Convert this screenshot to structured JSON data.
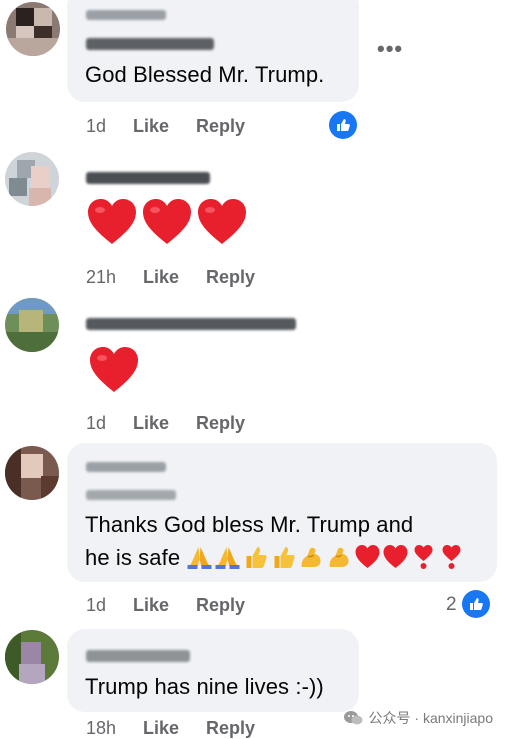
{
  "comments": [
    {
      "text": "God Blessed Mr. Trump.",
      "time": "1d",
      "like": "Like",
      "reply": "Reply",
      "more_icon": "•••"
    },
    {
      "time": "21h",
      "like": "Like",
      "reply": "Reply",
      "reaction": "3 red hearts"
    },
    {
      "time": "1d",
      "like": "Like",
      "reply": "Reply",
      "reaction": "1 red heart"
    },
    {
      "text_line1": "Thanks God bless Mr. Trump and",
      "text_line2": "he is safe",
      "time": "1d",
      "like": "Like",
      "reply": "Reply",
      "reaction_count": "2"
    },
    {
      "text": "Trump has nine lives :-))",
      "time": "18h",
      "like": "Like",
      "reply": "Reply"
    }
  ],
  "watermark": {
    "text": "公众号 · kanxinjiapo"
  },
  "colors": {
    "bubble": "#f0f2f5",
    "meta_text": "#65676b",
    "like_blue": "#1877f2",
    "heart_red": "#e8202e"
  }
}
